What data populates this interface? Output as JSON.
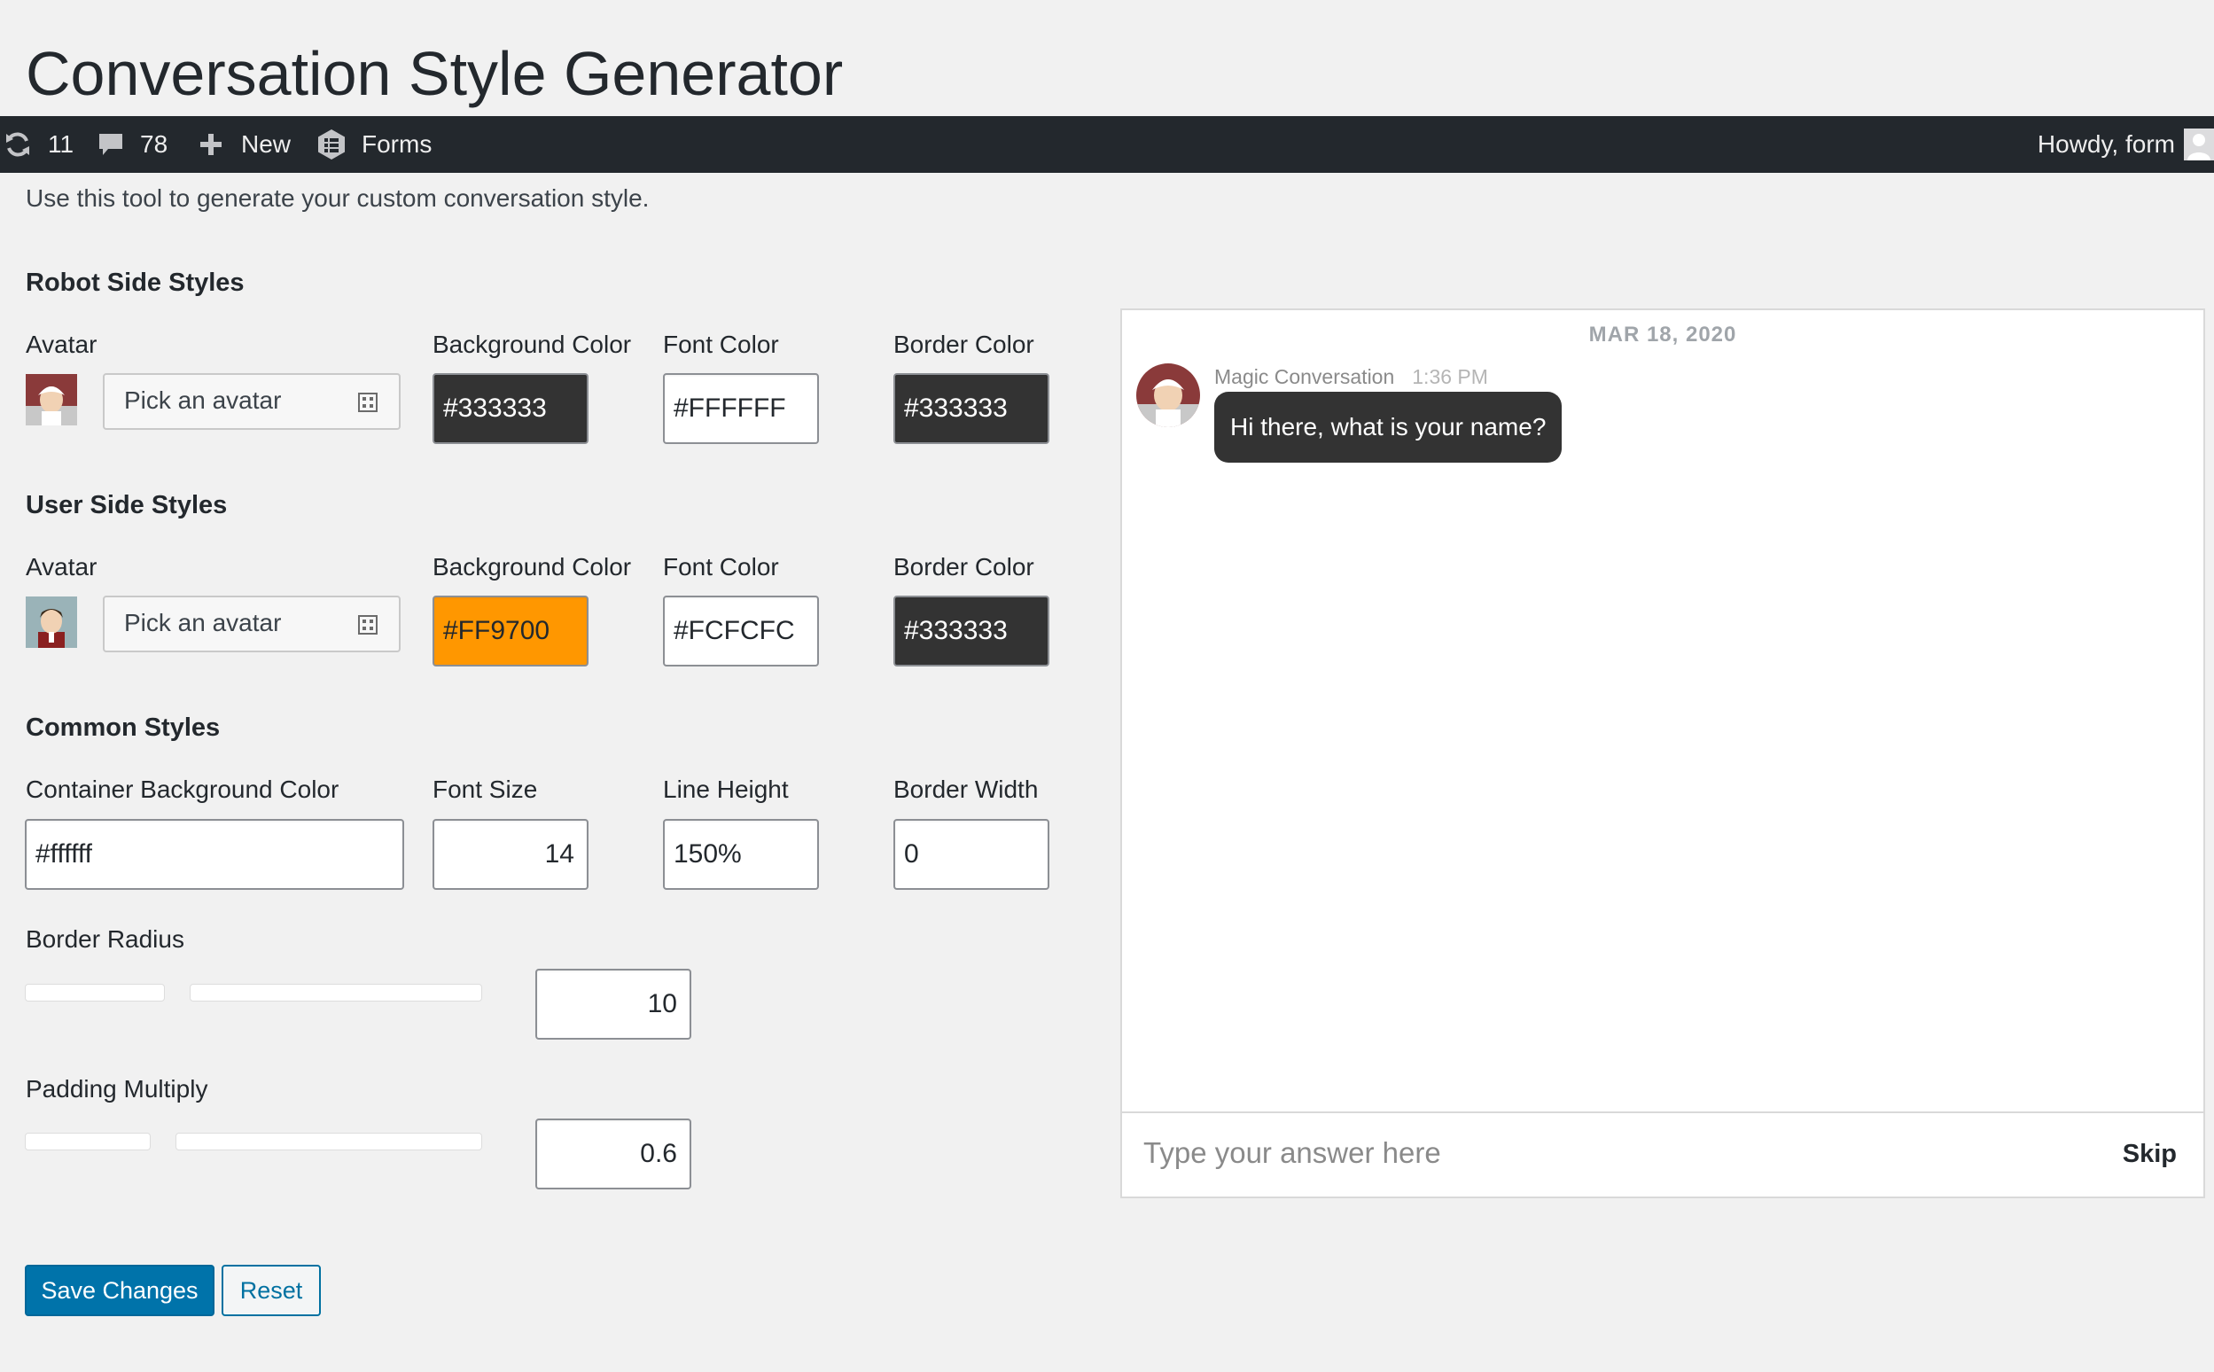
{
  "page": {
    "title": "Conversation Style Generator",
    "intro": "Use this tool to generate your custom conversation style."
  },
  "adminbar": {
    "updates_count": "11",
    "comments_count": "78",
    "new_label": "New",
    "forms_label": "Forms",
    "howdy": "Howdy, form"
  },
  "robot": {
    "heading": "Robot Side Styles",
    "avatar_label": "Avatar",
    "picker_placeholder": "Pick an avatar",
    "bg_label": "Background Color",
    "bg_value": "#333333",
    "font_label": "Font Color",
    "font_value": "#FFFFFF",
    "border_label": "Border Color",
    "border_value": "#333333"
  },
  "user": {
    "heading": "User Side Styles",
    "avatar_label": "Avatar",
    "picker_placeholder": "Pick an avatar",
    "bg_label": "Background Color",
    "bg_value": "#FF9700",
    "font_label": "Font Color",
    "font_value": "#FCFCFC",
    "border_label": "Border Color",
    "border_value": "#333333"
  },
  "common": {
    "heading": "Common Styles",
    "container_bg_label": "Container Background Color",
    "container_bg_value": "#ffffff",
    "font_size_label": "Font Size",
    "font_size_value": "14",
    "line_height_label": "Line Height",
    "line_height_value": "150%",
    "border_width_label": "Border Width",
    "border_width_value": "0",
    "border_radius_label": "Border Radius",
    "border_radius_value": "10",
    "padding_label": "Padding Multiply",
    "padding_value": "0.6"
  },
  "preview": {
    "date": "MAR 18, 2020",
    "sender": "Magic Conversation",
    "time": "1:36 PM",
    "message": "Hi there, what is your name?",
    "input_placeholder": "Type your answer here",
    "skip_label": "Skip"
  },
  "actions": {
    "save_label": "Save Changes",
    "reset_label": "Reset"
  },
  "colors": {
    "accent": "#0073aa",
    "adminbar": "#23282d",
    "robot_bubble": "#333333",
    "user_bubble": "#FF9700"
  },
  "icons": [
    "updates-icon",
    "comments-icon",
    "plus-icon",
    "forms-icon",
    "user-avatar-icon",
    "picker-icon"
  ]
}
